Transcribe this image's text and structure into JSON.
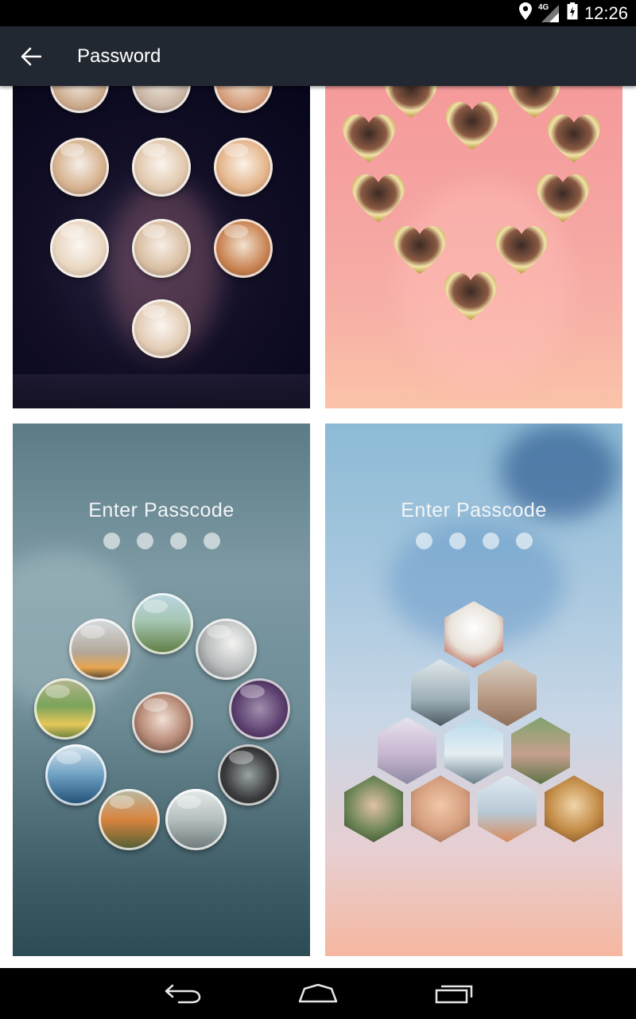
{
  "status_bar": {
    "time": "12:26",
    "network": "4G"
  },
  "app_bar": {
    "title": "Password"
  },
  "themes": [
    {
      "name": "dog-bubbles"
    },
    {
      "name": "baby-hearts"
    },
    {
      "name": "glass-bubbles",
      "title": "Enter Passcode",
      "dots": 4
    },
    {
      "name": "hexagon-photos",
      "title": "Enter Passcode",
      "dots": 4
    }
  ],
  "icons": {
    "back": "arrow-left-icon",
    "location": "location-pin-icon",
    "signal": "cell-signal-icon",
    "battery": "battery-charging-icon",
    "nav_back": "nav-back-icon",
    "nav_home": "nav-home-icon",
    "nav_recents": "nav-recents-icon"
  },
  "colors": {
    "app_bar": "#222831",
    "status_bar": "#000000",
    "nav_bar": "#000000"
  }
}
